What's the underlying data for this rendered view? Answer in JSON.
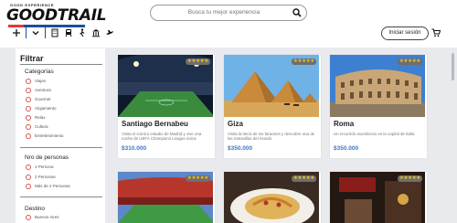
{
  "brand": {
    "tagline": "GOOD EXPERIENCE",
    "name": "GOODTRAIL"
  },
  "search": {
    "placeholder": "Busca tu mejor experiencia"
  },
  "header": {
    "login_label": "Iniciar sesión"
  },
  "filters": {
    "title": "Filtrar",
    "categories": {
      "title": "Categorías",
      "options": [
        "Viajes",
        "Aventura",
        "Gourmet",
        "Alojamiento",
        "Relax",
        "Cultura",
        "Entretenimiento"
      ]
    },
    "people": {
      "title": "Nro de personas",
      "options": [
        "1 Persona",
        "2 Personas",
        "Más de 2 Personas"
      ]
    },
    "destination": {
      "title": "Destino",
      "options": [
        "Buenos Aires"
      ]
    }
  },
  "cards": [
    {
      "title": "Santiago Bernabeu",
      "description": "Visita el icónico estadio de Madrid y vive una noche de UEFA Champions League única",
      "price": "$310.000",
      "stars": "★★★★★"
    },
    {
      "title": "Giza",
      "description": "Visita la tierra de los faraones y descubre una de las maravillas del mundo",
      "price": "$350.000",
      "stars": "★★★★★"
    },
    {
      "title": "Roma",
      "description": "Un recorrido asombroso en la capital de Italia",
      "price": "$350.000",
      "stars": "★★★★★"
    },
    {
      "title": "",
      "description": "",
      "price": "",
      "stars": "★★★★★"
    },
    {
      "title": "",
      "description": "",
      "price": "",
      "stars": "★★★★★"
    },
    {
      "title": "",
      "description": "",
      "price": "",
      "stars": "★★★★★"
    }
  ],
  "colors": {
    "accent": "#3f78c4",
    "brand_blue": "#1d4e9e",
    "radio": "#d9534f"
  },
  "icons": [
    "plus-icon",
    "chevron-down-icon",
    "building-icon",
    "train-icon",
    "hiker-icon",
    "landmark-icon",
    "airplane-icon",
    "cart-icon",
    "search-icon"
  ]
}
